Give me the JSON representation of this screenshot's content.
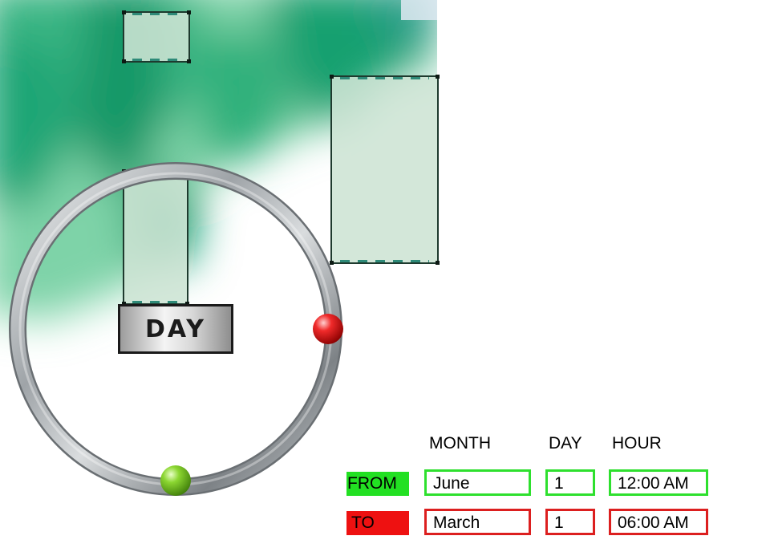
{
  "map": {
    "colors": {
      "dark_green": "#0e9a6a",
      "mid_green": "#4cc08c",
      "light_green": "#b7ead0"
    },
    "highlighted_blocks": 3
  },
  "dial": {
    "label": "DAY",
    "start_marker_color": "#7ed321",
    "end_marker_color": "#e21b1b",
    "ring_color": "#a9adb0"
  },
  "selector": {
    "headers": {
      "month": "MONTH",
      "day": "DAY",
      "hour": "HOUR"
    },
    "from": {
      "label": "FROM",
      "label_color": "#22e022",
      "month": "June",
      "day": "1",
      "hour": "12:00 AM"
    },
    "to": {
      "label": "TO",
      "label_color": "#ee1111",
      "month": "March",
      "day": "1",
      "hour": "06:00 AM"
    }
  }
}
